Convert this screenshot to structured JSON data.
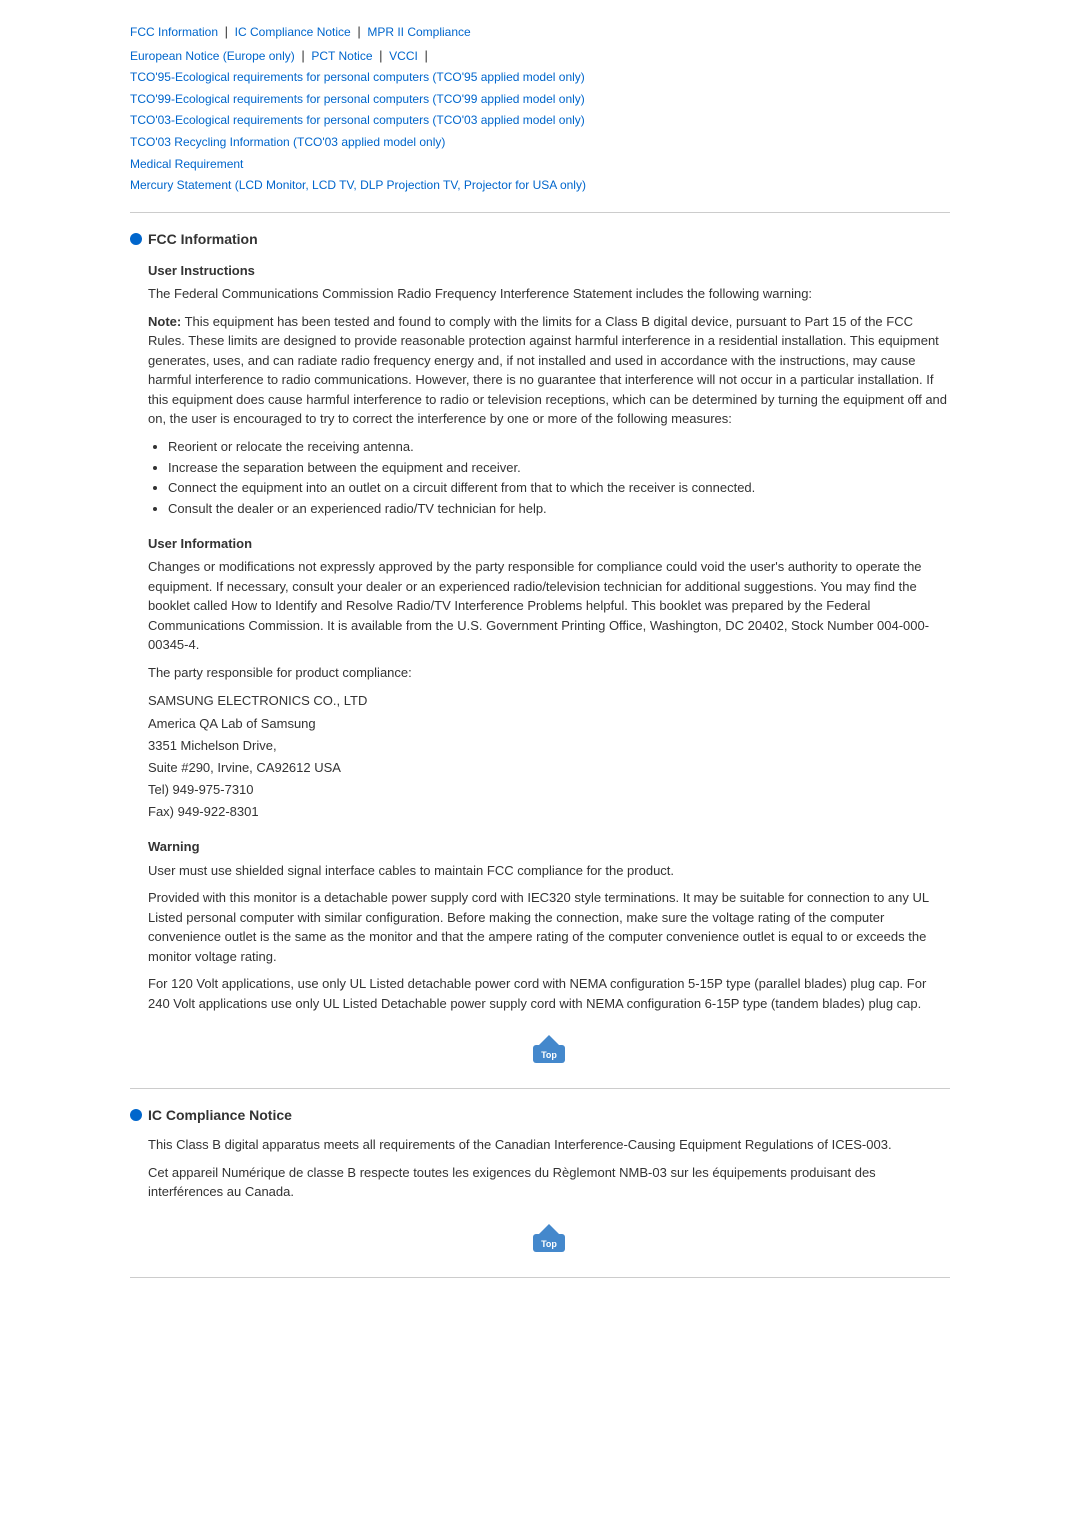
{
  "nav": {
    "links": [
      {
        "label": "FCC Information",
        "href": "#fcc"
      },
      {
        "label": "IC Compliance Notice",
        "href": "#ic"
      },
      {
        "label": "MPR II Compliance",
        "href": "#mpr"
      },
      {
        "label": "European Notice (Europe only)",
        "href": "#european"
      },
      {
        "label": "PCT Notice",
        "href": "#pct"
      },
      {
        "label": "VCCI",
        "href": "#vcci"
      }
    ],
    "tco_links": [
      "TCO'95-Ecological requirements for personal computers (TCO'95 applied model only)",
      "TCO'99-Ecological requirements for personal computers (TCO'99 applied model only)",
      "TCO'03-Ecological requirements for personal computers (TCO'03 applied model only)",
      "TCO'03 Recycling Information (TCO'03 applied model only)"
    ],
    "bottom_links": [
      {
        "label": "Medical Requirement",
        "href": "#medical"
      },
      {
        "label": "Mercury Statement (LCD Monitor, LCD TV, DLP Projection TV, Projector for USA only)",
        "href": "#mercury"
      }
    ]
  },
  "fcc_section": {
    "title": "FCC Information",
    "user_instructions": {
      "subtitle": "User Instructions",
      "para1": "The Federal Communications Commission Radio Frequency Interference Statement includes the following warning:",
      "note_start": "Note:",
      "note_text": " This equipment has been tested and found to comply with the limits for a Class B digital device, pursuant to Part 15 of the FCC Rules. These limits are designed to provide reasonable protection against harmful interference in a residential installation. This equipment generates, uses, and can radiate radio frequency energy and, if not installed and used in accordance with the instructions, may cause harmful interference to radio communications. However, there is no guarantee that interference will not occur in a particular installation. If this equipment does cause harmful interference to radio or television receptions, which can be determined by turning the equipment off and on, the user is encouraged to try to correct the interference by one or more of the following measures:",
      "bullets": [
        "Reorient or relocate the receiving antenna.",
        "Increase the separation between the equipment and receiver.",
        "Connect the equipment into an outlet on a circuit different from that to which the receiver is connected.",
        "Consult the dealer or an experienced radio/TV technician for help."
      ]
    },
    "user_information": {
      "subtitle": "User Information",
      "para1": "Changes or modifications not expressly approved by the party responsible for compliance could void the user's authority to operate the equipment. If necessary, consult your dealer or an experienced radio/television technician for additional suggestions. You may find the booklet called How to Identify and Resolve Radio/TV Interference Problems helpful. This booklet was prepared by the Federal Communications Commission. It is available from the U.S. Government Printing Office, Washington, DC 20402, Stock Number 004-000-00345-4.",
      "para2": "The party responsible for product compliance:",
      "address": [
        "SAMSUNG ELECTRONICS CO., LTD",
        "America QA Lab of Samsung",
        "3351 Michelson Drive,",
        "Suite #290, Irvine, CA92612 USA",
        "Tel) 949-975-7310",
        "Fax) 949-922-8301"
      ]
    },
    "warning": {
      "subtitle": "Warning",
      "para1": "User must use shielded signal interface cables to maintain FCC compliance for the product.",
      "para2": "Provided with this monitor is a detachable power supply cord with IEC320 style terminations. It may be suitable for connection to any UL Listed personal computer with similar configuration. Before making the connection, make sure the voltage rating of the computer convenience outlet is the same as the monitor and that the ampere rating of the computer convenience outlet is equal to or exceeds the monitor voltage rating.",
      "para3": "For 120 Volt applications, use only UL Listed detachable power cord with NEMA configuration 5-15P type (parallel blades) plug cap. For 240 Volt applications use only UL Listed Detachable power supply cord with NEMA configuration 6-15P type (tandem blades) plug cap."
    }
  },
  "ic_section": {
    "title": "IC Compliance Notice",
    "para1": "This Class B digital apparatus meets all requirements of the Canadian Interference-Causing Equipment Regulations of ICES-003.",
    "para2": "Cet appareil Numérique de classe B respecte toutes les exigences du Règlemont NMB-03 sur les équipements produisant des interférences au Canada."
  },
  "top_button_label": "Top"
}
